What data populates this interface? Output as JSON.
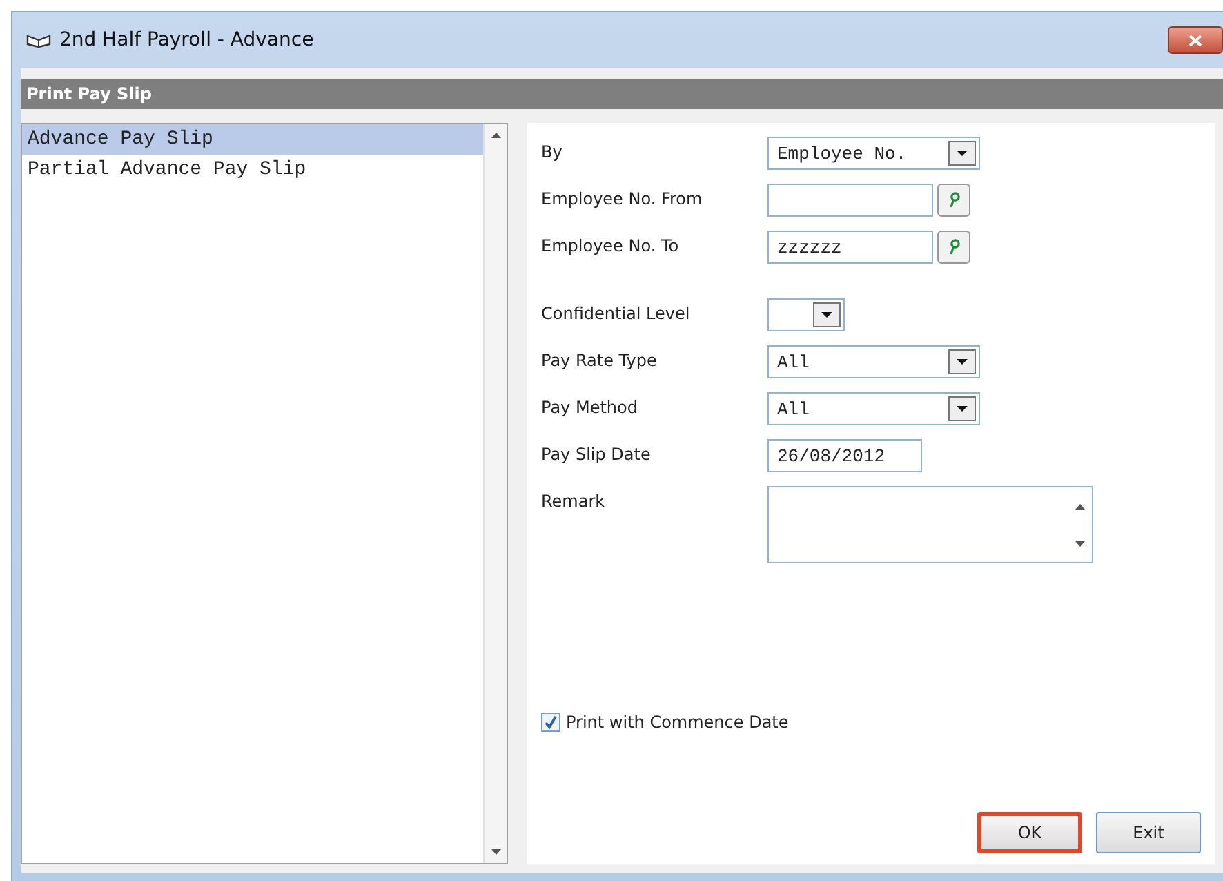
{
  "window": {
    "title": "2nd Half Payroll - Advance"
  },
  "section": {
    "title": "Print Pay Slip"
  },
  "report_list": [
    {
      "label": "Advance Pay Slip",
      "selected": true
    },
    {
      "label": "Partial Advance Pay Slip",
      "selected": false
    }
  ],
  "field_groups": [
    [
      {
        "label": "By",
        "kind": "dropdown",
        "value": "Employee No."
      },
      {
        "label": "Employee No. From",
        "kind": "lookup"
      },
      {
        "label": "Employee No. To",
        "kind": "lookup",
        "value": "zzzzzz"
      }
    ],
    [
      {
        "label": "Confidential Level",
        "kind": "small_dropdown"
      },
      {
        "label": "Pay Rate Type",
        "kind": "dropdown",
        "value": "All"
      },
      {
        "label": "Pay Method",
        "kind": "dropdown",
        "value": "All"
      },
      {
        "label": "Pay Slip Date",
        "kind": "date",
        "value": "26/08/2012"
      },
      {
        "label": "Remark",
        "kind": "textarea"
      }
    ]
  ],
  "print_with_commence_date": {
    "label": "Print with Commence Date",
    "checked": true
  },
  "buttons": [
    {
      "label": "OK",
      "focused": true
    },
    {
      "label": "Exit",
      "focused": false
    }
  ]
}
